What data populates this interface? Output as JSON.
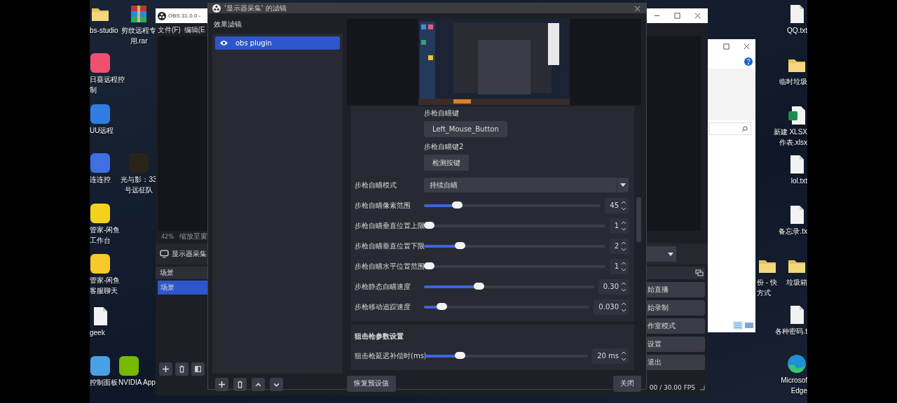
{
  "desktop": {
    "icons": [
      {
        "lines": [
          "bs-studio"
        ],
        "kind": "folder"
      },
      {
        "lines": [
          "日葵远程控",
          "制"
        ],
        "kind": "app",
        "color": "#f0506e"
      },
      {
        "lines": [
          "UU远程"
        ],
        "kind": "app",
        "color": "#2f7de1"
      },
      {
        "lines": [
          "连连控"
        ],
        "kind": "app",
        "color": "#3f6fe0"
      },
      {
        "lines": [
          "管家-闲鱼",
          "工作台"
        ],
        "kind": "app",
        "color": "#f5d21a"
      },
      {
        "lines": [
          "管家-闲鱼",
          "客服聊天"
        ],
        "kind": "app",
        "color": "#f7c92a"
      },
      {
        "lines": [
          "geek"
        ],
        "kind": "file"
      },
      {
        "lines": [
          "控制面板"
        ],
        "kind": "app",
        "color": "#4aa0e6"
      },
      {
        "lines": [
          "剪纹远程专",
          "用.rar"
        ],
        "kind": "archive"
      },
      {
        "lines": [
          "光与影：33",
          "号远征队"
        ],
        "kind": "app",
        "color": "#2a2418"
      },
      {
        "lines": [
          "NVIDIA App"
        ],
        "kind": "app",
        "color": "#76b900"
      },
      {
        "lines": [
          "份 - 快",
          "方式"
        ],
        "kind": "folder"
      },
      {
        "lines": [
          "QQ.txt"
        ],
        "kind": "file"
      },
      {
        "lines": [
          "临时垃圾"
        ],
        "kind": "folder"
      },
      {
        "lines": [
          "新建 XLSX",
          "作表.xlsx"
        ],
        "kind": "sheet"
      },
      {
        "lines": [
          "lol.txt"
        ],
        "kind": "file"
      },
      {
        "lines": [
          "备忘录.tx"
        ],
        "kind": "file"
      },
      {
        "lines": [
          "垃圾箱"
        ],
        "kind": "folder"
      },
      {
        "lines": [
          "各种密码.t"
        ],
        "kind": "file"
      },
      {
        "lines": [
          "Microsof",
          "Edge"
        ],
        "kind": "edge"
      }
    ]
  },
  "obs_window": {
    "title": "OBS 31.0.0 -",
    "menu": [
      "文件(F)",
      "编辑(E"
    ],
    "zoom": "42%",
    "zoom_action": "缩放至窗",
    "source": "显示器采集",
    "scenes": {
      "title": "场景",
      "items": [
        {
          "label": "场景",
          "selected": true
        }
      ]
    },
    "controls": [
      "始直播",
      "始录制",
      "作室模式",
      "设置",
      "退出"
    ],
    "fps": "00 / 30.00 FPS"
  },
  "filter_dialog": {
    "title": "'显示器采集' 的滤镜",
    "list_title": "效果滤镜",
    "filters": [
      {
        "label": "obs plugin",
        "visible": true,
        "selected": true
      }
    ],
    "settings": [
      {
        "kind": "key",
        "label": "步枪自瞄键",
        "button": "Left_Mouse_Button"
      },
      {
        "kind": "key",
        "label": "步枪自瞄键2",
        "button": "检测按键"
      },
      {
        "kind": "select",
        "label": "步枪自瞄模式",
        "value": "持续自瞄"
      },
      {
        "kind": "slider",
        "label": "步枪自瞄像素范围",
        "level": 0.17,
        "value": "45"
      },
      {
        "kind": "slider",
        "label": "步枪自瞄垂直位置上限",
        "level": 0.0,
        "value": "1"
      },
      {
        "kind": "slider",
        "label": "步枪自瞄垂直位置下限",
        "level": 0.18,
        "value": "2"
      },
      {
        "kind": "slider",
        "label": "步枪自瞄水平位置范围",
        "level": 0.0,
        "value": "1"
      },
      {
        "kind": "slider",
        "label": "步枪静态自瞄速度",
        "level": 0.31,
        "value": "0.30"
      },
      {
        "kind": "slider",
        "label": "步枪移动追踪速度",
        "level": 0.08,
        "value": "0.030"
      }
    ],
    "section": {
      "title": "狙击枪参数设置",
      "settings": [
        {
          "kind": "slider",
          "label": "狙击枪延迟补偿时(ms)",
          "level": 0.2,
          "value": "20 ms"
        }
      ]
    },
    "reset_button": "恢复预设值",
    "close_button": "关闭"
  }
}
